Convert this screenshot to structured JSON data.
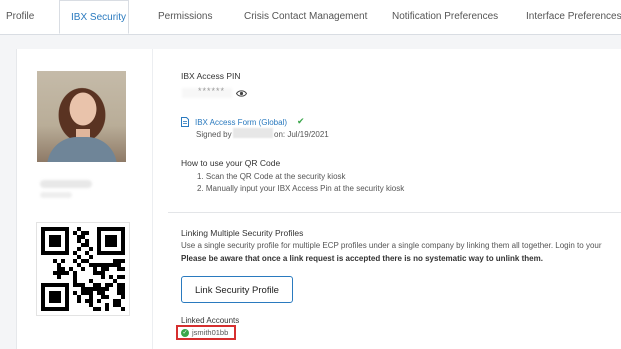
{
  "tabs": [
    {
      "label": "Profile"
    },
    {
      "label": "IBX Security"
    },
    {
      "label": "Permissions"
    },
    {
      "label": "Crisis Contact Management"
    },
    {
      "label": "Notification Preferences"
    },
    {
      "label": "Interface Preferences"
    }
  ],
  "active_tab": "IBX Security",
  "security": {
    "pin_label": "IBX Access PIN",
    "pin_value": "******",
    "form_link": "IBX Access Form (Global)",
    "signed_by_prefix": "Signed by",
    "signed_on": "on: Jul/19/2021",
    "qr_heading": "How to use your QR Code",
    "qr_step1": "1. Scan the QR Code at the security kiosk",
    "qr_step2": "2. Manually input your IBX Access Pin at the security kiosk"
  },
  "linking": {
    "heading": "Linking Multiple Security Profiles",
    "description": "Use a single security profile for multiple ECP profiles under a single company by linking them all together. Login to your",
    "warning": "Please be aware that once a link request is accepted there is no systematic way to unlink them.",
    "button_label": "Link Security Profile",
    "linked_label": "Linked Accounts",
    "linked_account": "jsmith01bb"
  },
  "icons": {
    "eye": "eye-icon",
    "doc": "document-icon",
    "check": "check-icon",
    "linked_status": "check-circle-icon"
  },
  "colors": {
    "accent": "#2a7abf",
    "success": "#3aa64a",
    "highlight": "#d62f2f"
  }
}
